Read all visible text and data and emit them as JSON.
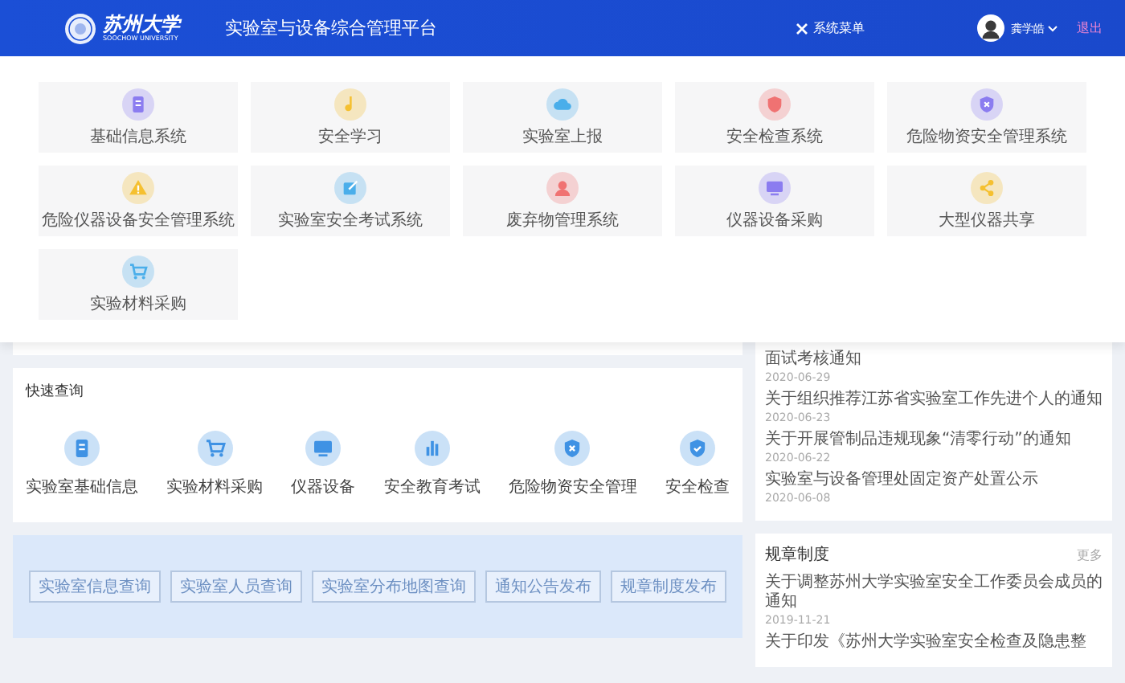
{
  "header": {
    "logo_text": "苏州大学",
    "logo_subtext": "SOOCHOW UNIVERSITY",
    "title": "实验室与设备综合管理平台",
    "menu_toggle": "系统菜单",
    "user": "龚学皓",
    "logout": "退出"
  },
  "system_menu": {
    "tiles": [
      "基础信息系统",
      "安全学习",
      "实验室上报",
      "安全检查系统",
      "危险物资安全管理系统",
      "危险仪器设备安全管理系统",
      "实验室安全考试系统",
      "废弃物管理系统",
      "仪器设备采购",
      "大型仪器共享",
      "实验材料采购"
    ]
  },
  "quick_query": {
    "title": "快速查询",
    "items": [
      "实验室基础信息",
      "实验材料采购",
      "仪器设备",
      "安全教育考试",
      "危险物资安全管理",
      "安全检查"
    ]
  },
  "query_buttons": [
    "实验室信息查询",
    "实验室人员查询",
    "实验室分布地图查询",
    "通知公告发布",
    "规章制度发布"
  ],
  "news": {
    "items": [
      {
        "title": "面试考核通知",
        "date": "2020-06-29"
      },
      {
        "title": "关于组织推荐江苏省实验室工作先进个人的通知",
        "date": "2020-06-23"
      },
      {
        "title": "关于开展管制品违规现象“清零行动”的通知",
        "date": "2020-06-22"
      },
      {
        "title": "实验室与设备管理处固定资产处置公示",
        "date": "2020-06-08"
      }
    ]
  },
  "rules": {
    "title": "规章制度",
    "more": "更多",
    "items": [
      {
        "title": "关于调整苏州大学实验室安全工作委员会成员的通知",
        "date": "2019-11-21"
      },
      {
        "title": "关于印发《苏州大学实验室安全检查及隐患整"
      }
    ]
  }
}
